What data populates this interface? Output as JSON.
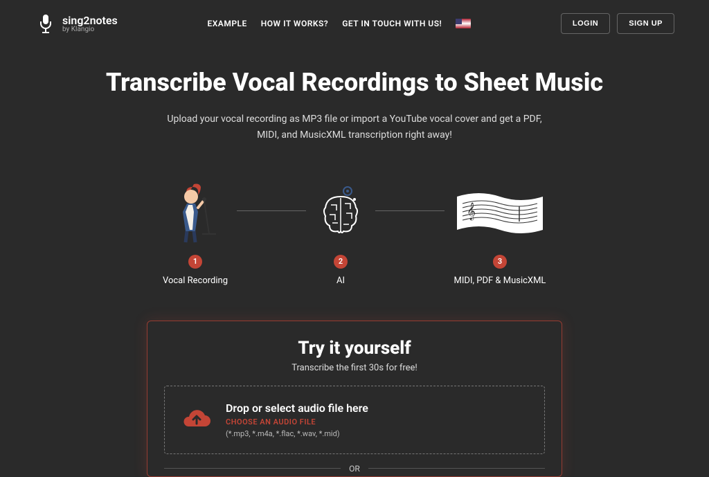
{
  "logo": {
    "name": "sing2notes",
    "byline": "by Klangio"
  },
  "nav": {
    "example": "EXAMPLE",
    "how": "HOW IT WORKS?",
    "contact": "GET IN TOUCH WITH US!"
  },
  "auth": {
    "login": "LOGIN",
    "signup": "SIGN UP"
  },
  "hero": {
    "title": "Transcribe Vocal Recordings to Sheet Music",
    "subtitle": "Upload your vocal recording as MP3 file or import a YouTube vocal cover and get a PDF, MIDI, and MusicXML transcription right away!"
  },
  "steps": {
    "s1": {
      "num": "1",
      "label": "Vocal Recording"
    },
    "s2": {
      "num": "2",
      "label": "AI"
    },
    "s3": {
      "num": "3",
      "label": "MIDI, PDF & MusicXML"
    }
  },
  "try": {
    "title": "Try it yourself",
    "subtitle": "Transcribe the first 30s for free!",
    "drop_title": "Drop or select audio file here",
    "choose": "CHOOSE AN AUDIO FILE",
    "formats": "(*.mp3, *.m4a, *.flac, *.wav, *.mid)",
    "or": "OR"
  }
}
